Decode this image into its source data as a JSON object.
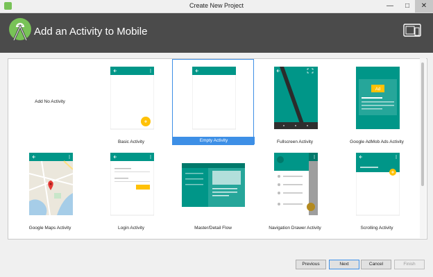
{
  "window": {
    "title": "Create New Project"
  },
  "header": {
    "title": "Add an Activity to Mobile"
  },
  "gallery": {
    "selected": "Empty Activity",
    "activities": [
      "Add No Activity",
      "Basic Activity",
      "Empty Activity",
      "Fullscreen Activity",
      "Google AdMob Ads Activity",
      "Google Maps Activity",
      "Login Activity",
      "Master/Detail Flow",
      "Navigation Drawer Activity",
      "Scrolling Activity"
    ],
    "ad_badge": "Ad"
  },
  "buttons": {
    "previous": "Previous",
    "next": "Next",
    "cancel": "Cancel",
    "finish": "Finish"
  },
  "colors": {
    "teal": "#009688",
    "dark_teal": "#00796b",
    "fab": "#ffc107",
    "selection": "#3d8fe6",
    "header_bg": "#4b4b4b"
  }
}
